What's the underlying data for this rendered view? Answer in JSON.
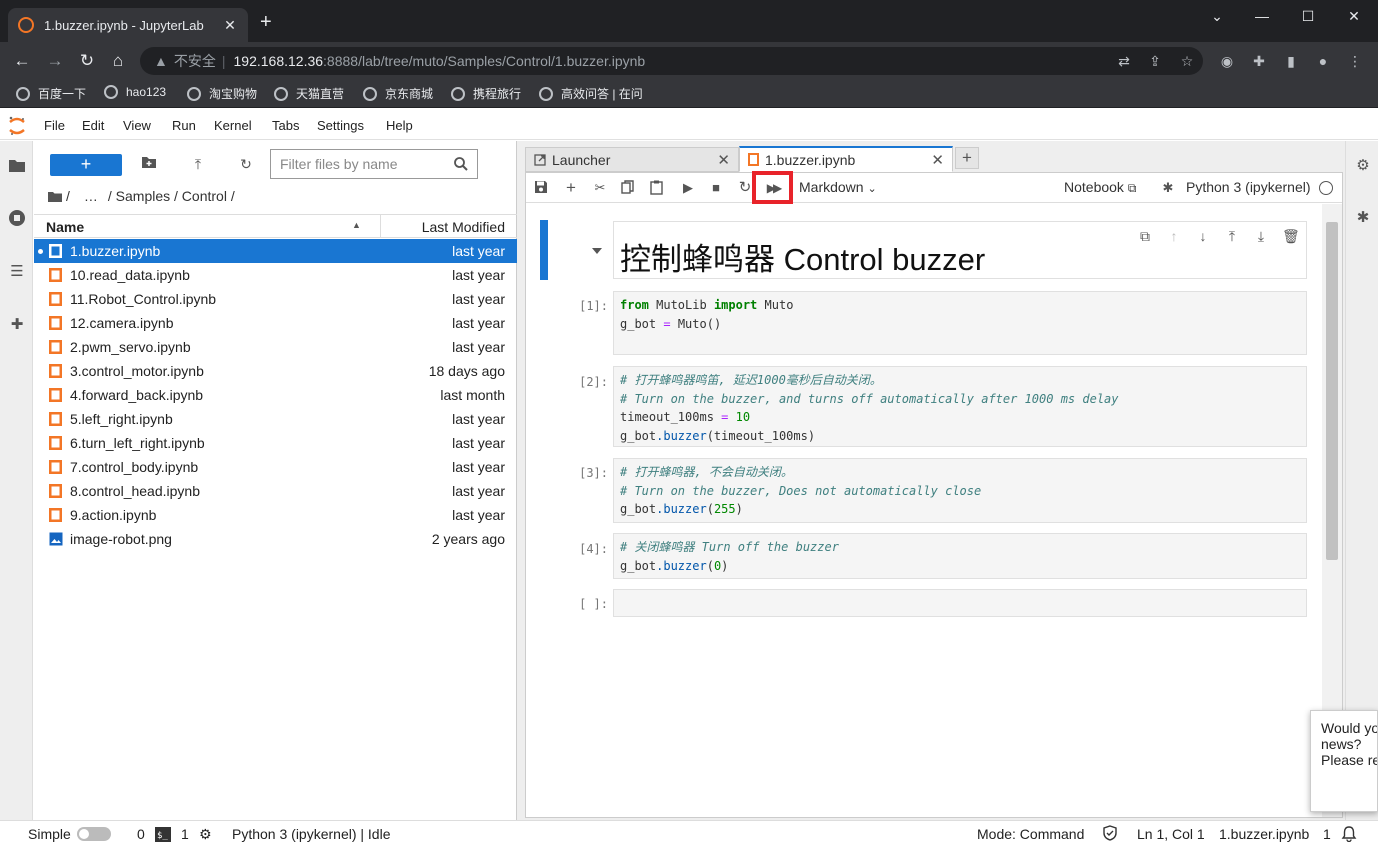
{
  "browser": {
    "tab_title": "1.buzzer.ipynb - JupyterLab",
    "not_secure": "不安全",
    "url_host": "192.168.12.36",
    "url_rest": ":8888/lab/tree/muto/Samples/Control/1.buzzer.ipynb",
    "bookmarks": [
      "百度一下",
      "hao123",
      "淘宝购物",
      "天猫直营",
      "京东商城",
      "携程旅行",
      "高效问答 | 在问"
    ]
  },
  "menu": [
    "File",
    "Edit",
    "View",
    "Run",
    "Kernel",
    "Tabs",
    "Settings",
    "Help"
  ],
  "filebrowser": {
    "new_label": "+",
    "filter_placeholder": "Filter files by name",
    "crumb_root": "/",
    "crumb_ellipsis": "…",
    "crumb_path": "/ Samples / Control /",
    "col_name": "Name",
    "col_modified": "Last Modified",
    "files": [
      {
        "name": "1.buzzer.ipynb",
        "modified": "last year"
      },
      {
        "name": "10.read_data.ipynb",
        "modified": "last year"
      },
      {
        "name": "11.Robot_Control.ipynb",
        "modified": "last year"
      },
      {
        "name": "12.camera.ipynb",
        "modified": "last year"
      },
      {
        "name": "2.pwm_servo.ipynb",
        "modified": "last year"
      },
      {
        "name": "3.control_motor.ipynb",
        "modified": "18 days ago"
      },
      {
        "name": "4.forward_back.ipynb",
        "modified": "last month"
      },
      {
        "name": "5.left_right.ipynb",
        "modified": "last year"
      },
      {
        "name": "6.turn_left_right.ipynb",
        "modified": "last year"
      },
      {
        "name": "7.control_body.ipynb",
        "modified": "last year"
      },
      {
        "name": "8.control_head.ipynb",
        "modified": "last year"
      },
      {
        "name": "9.action.ipynb",
        "modified": "last year"
      },
      {
        "name": "image-robot.png",
        "modified": "2 years ago"
      }
    ]
  },
  "tabs": {
    "launcher": "Launcher",
    "notebook": "1.buzzer.ipynb",
    "add": "+"
  },
  "toolbar": {
    "cell_type": "Markdown",
    "notebook_label": "Notebook",
    "kernel": "Python 3 (ipykernel)"
  },
  "notebook": {
    "heading": "控制蜂鸣器 Control buzzer",
    "prompts": [
      "[1]:",
      "[2]:",
      "[3]:",
      "[4]:",
      "[ ]:"
    ],
    "c1": {
      "l1_kw1": "from",
      "l1_mod": " MutoLib ",
      "l1_kw2": "import",
      "l1_name": " Muto",
      "l2a": "g_bot ",
      "l2op": "=",
      "l2b": " Muto()"
    },
    "c2": {
      "comment1": "# 打开蜂鸣器鸣笛, 延迟1000毫秒后自动关闭。",
      "comment2": "# Turn on the buzzer, and turns off automatically after 1000 ms delay",
      "l3a": "timeout_100ms ",
      "l3op": "=",
      "l3num": " 10",
      "l4a": "g_bot",
      "l4attr": ".buzzer",
      "l4b": "(timeout_100ms)"
    },
    "c3": {
      "comment1": "# 打开蜂鸣器, 不会自动关闭。",
      "comment2": "# Turn on the buzzer, Does not automatically close",
      "l3a": "g_bot",
      "l3attr": ".buzzer",
      "l3b": "(",
      "l3num": "255",
      "l3c": ")"
    },
    "c4": {
      "comment1": "# 关闭蜂鸣器 Turn off the buzzer",
      "l2a": "g_bot",
      "l2attr": ".buzzer",
      "l2b": "(",
      "l2num": "0",
      "l2c": ")"
    }
  },
  "popup": {
    "l1": "Would yo",
    "l2": "news?",
    "l3": "Please re"
  },
  "status": {
    "simple": "Simple",
    "count0": "0",
    "count1": "1",
    "kernel_status": "Python 3 (ipykernel) | Idle",
    "mode": "Mode: Command",
    "position": "Ln 1, Col 1",
    "file": "1.buzzer.ipynb",
    "notifications": "1"
  },
  "colors": {
    "accent": "#1976d2",
    "highlight_box": "#e8232a",
    "notebook_icon": "#f37626"
  }
}
